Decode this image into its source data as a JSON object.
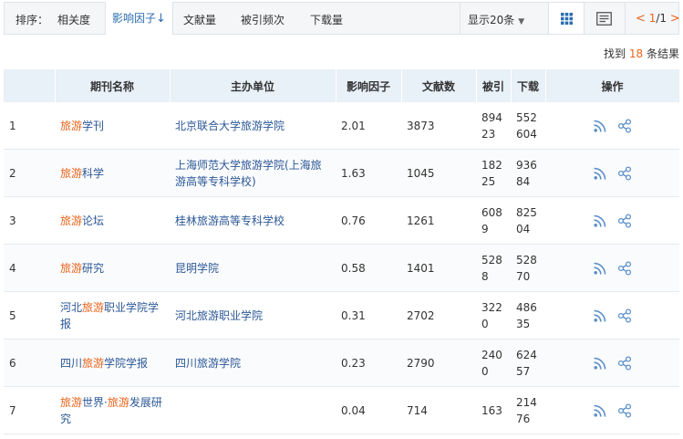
{
  "sortbar": {
    "label": "排序：",
    "options": [
      {
        "label": "相关度"
      },
      {
        "label": "影响因子",
        "arrow": "↓",
        "active": true
      },
      {
        "label": "文献量"
      },
      {
        "label": "被引频次"
      },
      {
        "label": "下载量"
      }
    ],
    "page_size": "显示20条",
    "page_size_caret": "▼",
    "view_grid_icon": "grid-view-icon",
    "view_list_icon": "list-view-icon",
    "pager": {
      "prev": "<",
      "current": "1",
      "sep": "/",
      "total": "1",
      "next": ">"
    }
  },
  "summary": {
    "prefix": "找到",
    "count": "18",
    "suffix": "条结果"
  },
  "table": {
    "headers": [
      "",
      "期刊名称",
      "主办单位",
      "影响因子",
      "文献数",
      "被引",
      "下载",
      "操作"
    ],
    "rows": [
      {
        "idx": "1",
        "name_parts": [
          {
            "t": "旅游",
            "hl": true
          },
          {
            "t": "学刊",
            "hl": false
          }
        ],
        "org": "北京联合大学旅游学院",
        "impact": "2.01",
        "docs": "3873",
        "cited": "89423",
        "downloads": "552604"
      },
      {
        "idx": "2",
        "name_parts": [
          {
            "t": "旅游",
            "hl": true
          },
          {
            "t": "科学",
            "hl": false
          }
        ],
        "org": "上海师范大学旅游学院(上海旅游高等专科学校)",
        "impact": "1.63",
        "docs": "1045",
        "cited": "18225",
        "downloads": "93684"
      },
      {
        "idx": "3",
        "name_parts": [
          {
            "t": "旅游",
            "hl": true
          },
          {
            "t": "论坛",
            "hl": false
          }
        ],
        "org": "桂林旅游高等专科学校",
        "impact": "0.76",
        "docs": "1261",
        "cited": "6089",
        "downloads": "82504"
      },
      {
        "idx": "4",
        "name_parts": [
          {
            "t": "旅游",
            "hl": true
          },
          {
            "t": "研究",
            "hl": false
          }
        ],
        "org": "昆明学院",
        "impact": "0.58",
        "docs": "1401",
        "cited": "5288",
        "downloads": "52870"
      },
      {
        "idx": "5",
        "name_parts": [
          {
            "t": "河北",
            "hl": false
          },
          {
            "t": "旅游",
            "hl": true
          },
          {
            "t": "职业学院学报",
            "hl": false
          }
        ],
        "org": "河北旅游职业学院",
        "impact": "0.31",
        "docs": "2702",
        "cited": "3220",
        "downloads": "48635"
      },
      {
        "idx": "6",
        "name_parts": [
          {
            "t": "四川",
            "hl": false
          },
          {
            "t": "旅游",
            "hl": true
          },
          {
            "t": "学院学报",
            "hl": false
          }
        ],
        "org": "四川旅游学院",
        "impact": "0.23",
        "docs": "2790",
        "cited": "2400",
        "downloads": "62457"
      },
      {
        "idx": "7",
        "name_parts": [
          {
            "t": "旅游",
            "hl": true
          },
          {
            "t": "世界·",
            "hl": false
          },
          {
            "t": "旅游",
            "hl": true
          },
          {
            "t": "发展研究",
            "hl": false
          }
        ],
        "org": "",
        "impact": "0.04",
        "docs": "714",
        "cited": "163",
        "downloads": "21476"
      }
    ],
    "op_icons": [
      "rss-icon",
      "share-icon"
    ]
  },
  "colors": {
    "accent": "#2b6cb0",
    "highlight": "#e8641b",
    "header_bg": "#e8f0f8",
    "icon": "#5a8fc8"
  }
}
